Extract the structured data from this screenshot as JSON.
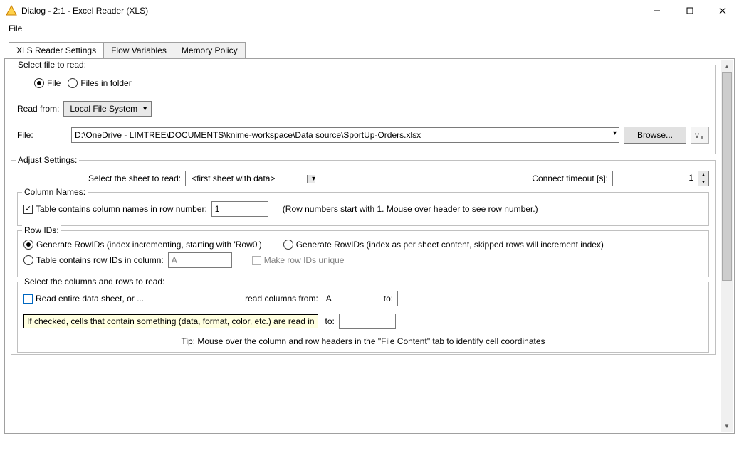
{
  "title": "Dialog - 2:1 - Excel Reader (XLS)",
  "menubar": {
    "file": "File"
  },
  "tabs": [
    "XLS Reader Settings",
    "Flow Variables",
    "Memory Policy"
  ],
  "selectFile": {
    "legend": "Select file to read:",
    "file": "File",
    "filesInFolder": "Files in folder",
    "readFromLabel": "Read from:",
    "readFromValue": "Local File System",
    "fileLabel": "File:",
    "filePath": "D:\\OneDrive - LIMTREE\\DOCUMENTS\\knime-workspace\\Data source\\SportUp-Orders.xlsx",
    "browse": "Browse..."
  },
  "adjust": {
    "legend": "Adjust Settings:",
    "sheetLabel": "Select the sheet to read:",
    "sheetValue": "<first sheet with data>",
    "timeoutLabel": "Connect timeout [s]:",
    "timeoutValue": "1"
  },
  "colNames": {
    "legend": "Column Names:",
    "check": "Table contains column names in row number:",
    "rowNumber": "1",
    "hint": "(Row numbers start with 1. Mouse over header to see row number.)"
  },
  "rowIds": {
    "legend": "Row IDs:",
    "opt1": "Generate RowIDs (index incrementing, starting with 'Row0')",
    "opt2": "Generate RowIDs (index as per sheet content, skipped rows will increment index)",
    "opt3": "Table contains row IDs in column:",
    "colValue": "A",
    "uniqueLabel": "Make row IDs unique"
  },
  "colsRows": {
    "legend": "Select the columns and rows to read:",
    "readEntire": "Read entire data sheet, or ...",
    "readColsFrom": "read columns from:",
    "colFrom": "A",
    "to": "to:",
    "tooltip": "If checked, cells that contain something (data, format, color, etc.) are read in",
    "tip": "Tip: Mouse over the column and row headers in the \"File Content\" tab to identify cell coordinates"
  }
}
